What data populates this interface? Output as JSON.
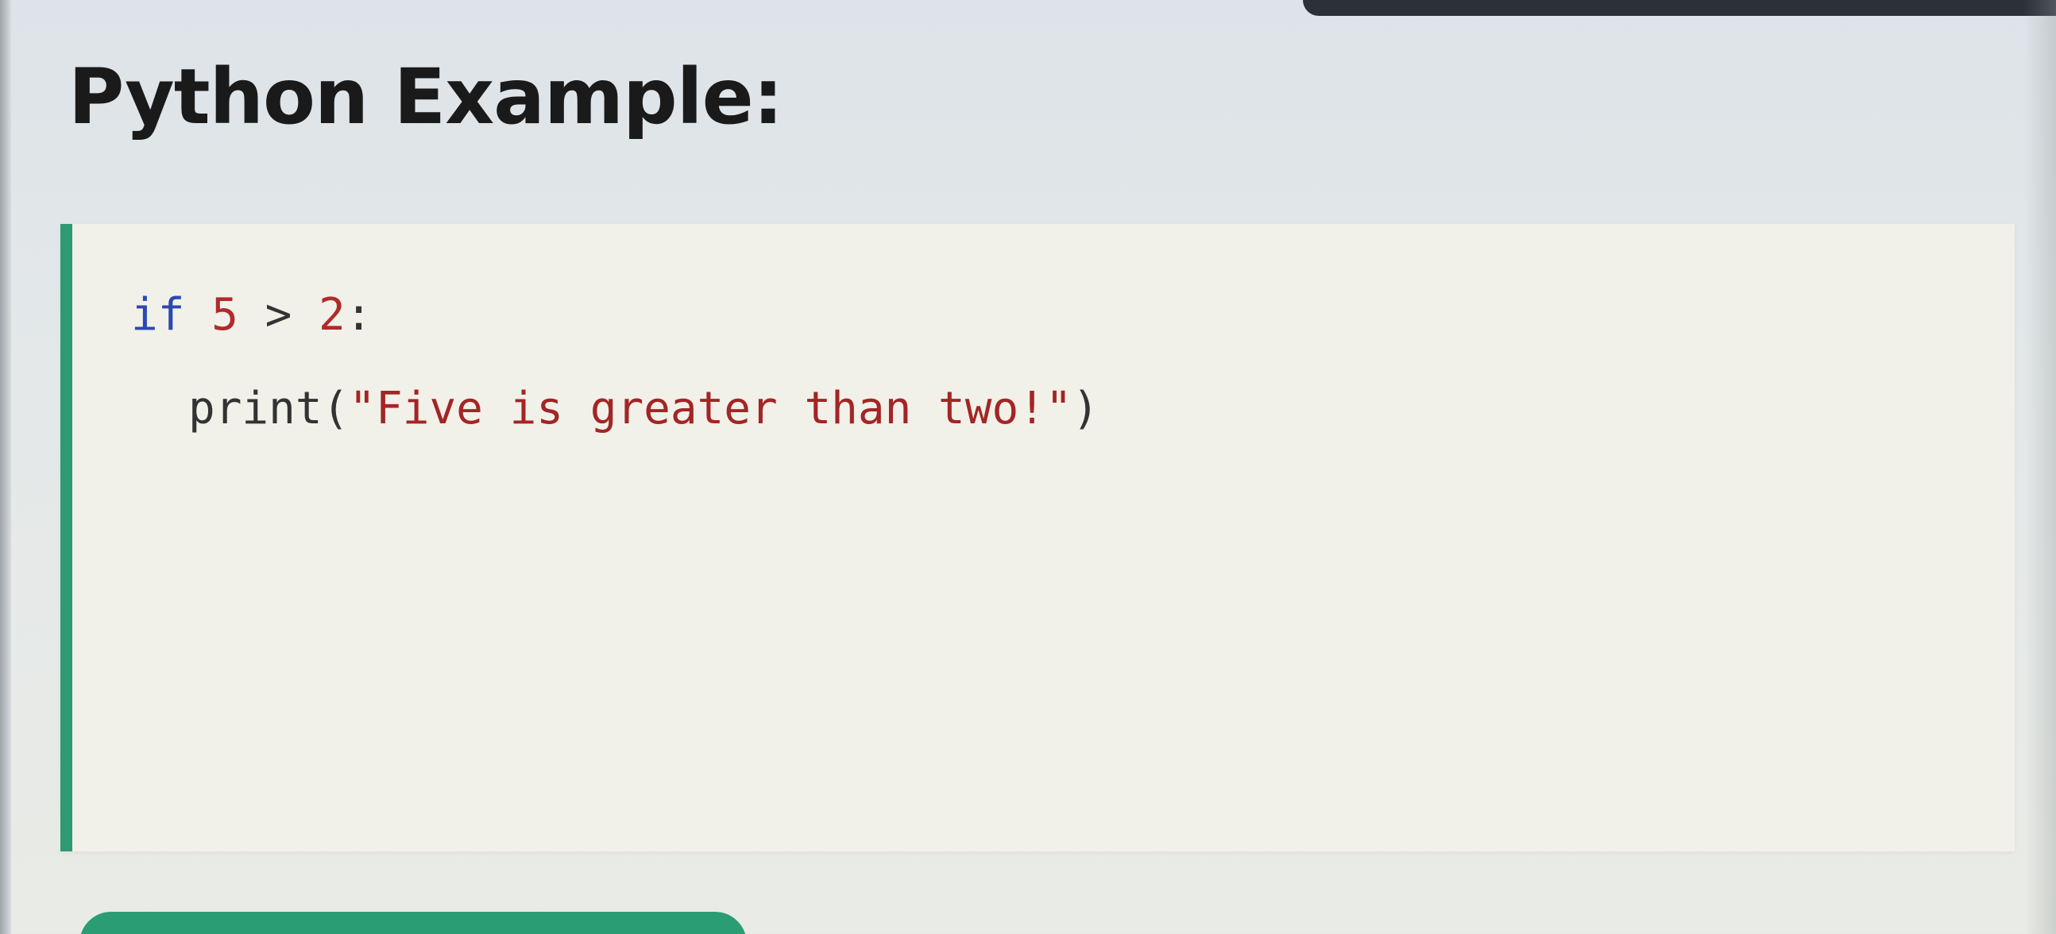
{
  "page": {
    "title": "Python Example:"
  },
  "code": {
    "line1": {
      "keyword": "if",
      "left": "5",
      "operator": ">",
      "right": "2",
      "colon": ":"
    },
    "line2": {
      "function": "print",
      "open": "(",
      "string": "\"Five is greater than two!\"",
      "close": ")"
    }
  },
  "colors": {
    "accent": "#2e9972",
    "keyword": "#2c48b0",
    "number": "#b12a2a",
    "string": "#a32525"
  }
}
